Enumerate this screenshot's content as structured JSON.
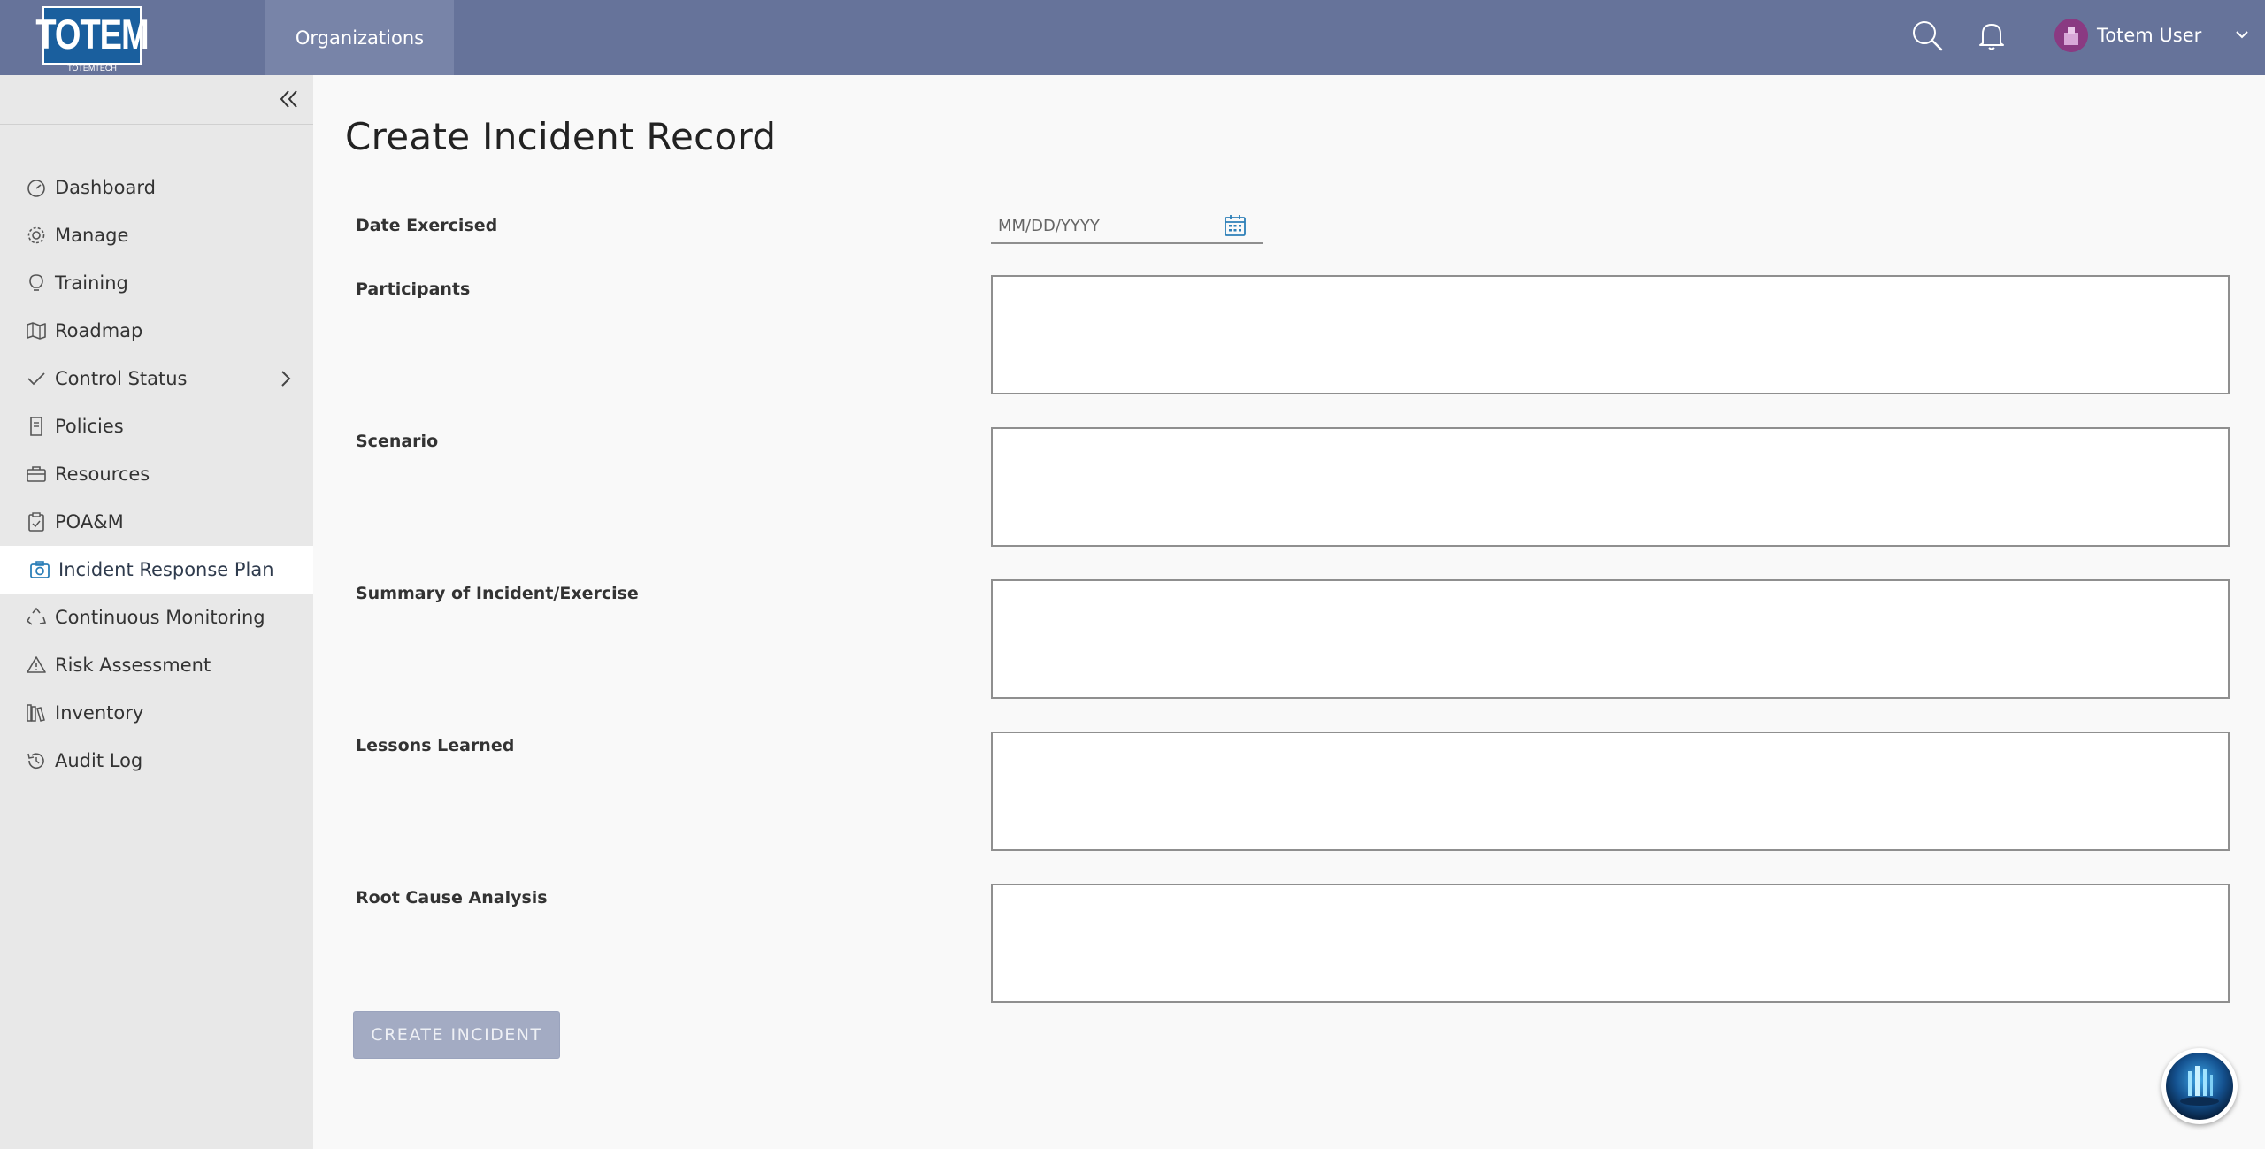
{
  "header": {
    "logo_text": "TOTEM",
    "logo_subtext": "TOTEMTECH",
    "org_tab_label": "Organizations",
    "user_name": "Totem User"
  },
  "sidebar": {
    "items": [
      {
        "label": "Dashboard",
        "icon": "gauge-icon"
      },
      {
        "label": "Manage",
        "icon": "gear-icon"
      },
      {
        "label": "Training",
        "icon": "lightbulb-icon"
      },
      {
        "label": "Roadmap",
        "icon": "map-icon"
      },
      {
        "label": "Control Status",
        "icon": "check-icon"
      },
      {
        "label": "Policies",
        "icon": "document-icon"
      },
      {
        "label": "Resources",
        "icon": "briefcase-icon"
      },
      {
        "label": "POA&M",
        "icon": "clipboard-icon"
      },
      {
        "label": "Incident Response Plan",
        "icon": "camera-icon",
        "active": true
      },
      {
        "label": "Continuous Monitoring",
        "icon": "recycle-icon"
      },
      {
        "label": "Risk Assessment",
        "icon": "warning-icon"
      },
      {
        "label": "Inventory",
        "icon": "books-icon"
      },
      {
        "label": "Audit Log",
        "icon": "history-icon"
      }
    ]
  },
  "main": {
    "title": "Create Incident Record",
    "date_label": "Date Exercised",
    "date_placeholder": "MM/DD/YYYY",
    "fields": [
      {
        "label": "Participants",
        "value": ""
      },
      {
        "label": "Scenario",
        "value": ""
      },
      {
        "label": "Summary of Incident/Exercise",
        "value": ""
      },
      {
        "label": "Lessons Learned",
        "value": ""
      },
      {
        "label": "Root Cause Analysis",
        "value": ""
      }
    ],
    "submit_label": "CREATE INCIDENT"
  },
  "colors": {
    "topbar": "#66739a",
    "org_tab": "#7884a8",
    "sidebar_bg": "#e8e8e8",
    "button_disabled": "#a3abc3",
    "accent_icon": "#2c7fb8"
  }
}
